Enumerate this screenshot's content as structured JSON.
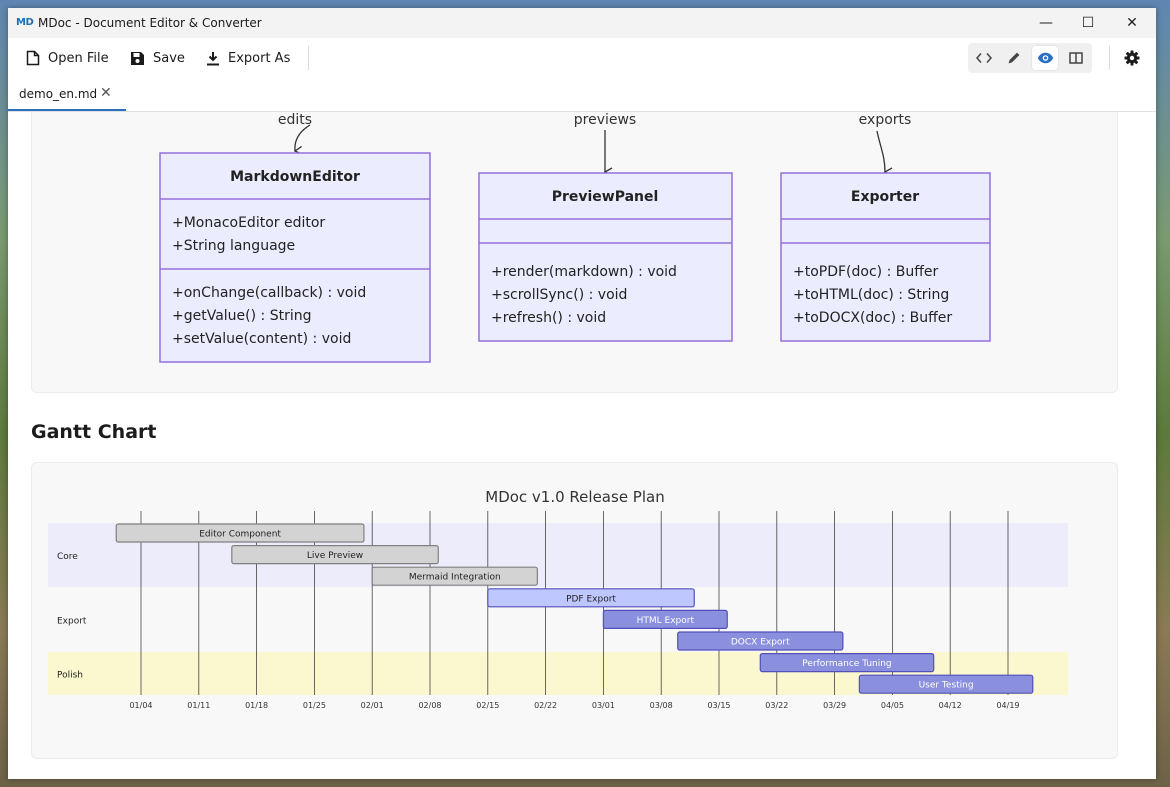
{
  "window": {
    "app_logo": "MD",
    "title": "MDoc - Document Editor & Converter",
    "controls": {
      "minimize": "—",
      "maximize": "☐",
      "close": "✕"
    }
  },
  "toolbar": {
    "open_label": "Open File",
    "save_label": "Save",
    "export_label": "Export As",
    "view_modes": [
      {
        "icon": "code-icon",
        "active": false
      },
      {
        "icon": "pencil-icon",
        "active": false
      },
      {
        "icon": "eye-icon",
        "active": true
      },
      {
        "icon": "split-view-icon",
        "active": false
      }
    ],
    "settings_icon": "gear-icon"
  },
  "tabs": [
    {
      "label": "demo_en.md",
      "close": "✕",
      "active": true
    }
  ],
  "class_diagram": {
    "relations": [
      "edits",
      "previews",
      "exports"
    ],
    "classes": [
      {
        "name": "MarkdownEditor",
        "attributes": [
          "+MonacoEditor editor",
          "+String language"
        ],
        "methods": [
          "+onChange(callback) : void",
          "+getValue() : String",
          "+setValue(content) : void"
        ]
      },
      {
        "name": "PreviewPanel",
        "attributes": [],
        "methods": [
          "+render(markdown) : void",
          "+scrollSync() : void",
          "+refresh() : void"
        ]
      },
      {
        "name": "Exporter",
        "attributes": [],
        "methods": [
          "+toPDF(doc) : Buffer",
          "+toHTML(doc) : String",
          "+toDOCX(doc) : Buffer"
        ]
      }
    ]
  },
  "gantt_heading": "Gantt Chart",
  "chart_data": {
    "type": "gantt",
    "title": "MDoc v1.0 Release Plan",
    "x_axis": "date",
    "x_ticks": [
      "01/04",
      "01/11",
      "01/18",
      "01/25",
      "02/01",
      "02/08",
      "02/15",
      "02/22",
      "03/01",
      "03/08",
      "03/15",
      "03/22",
      "03/29",
      "04/05",
      "04/12",
      "04/19"
    ],
    "sections": [
      {
        "name": "Core",
        "color": "#ececfb",
        "tasks": [
          {
            "name": "Editor Component",
            "start": "2025-01-01",
            "end": "2025-01-31",
            "status": "done"
          },
          {
            "name": "Live Preview",
            "start": "2025-01-15",
            "end": "2025-02-09",
            "status": "done"
          },
          {
            "name": "Mermaid Integration",
            "start": "2025-02-01",
            "end": "2025-02-21",
            "status": "done"
          }
        ]
      },
      {
        "name": "Export",
        "color": "#f8f8f8",
        "tasks": [
          {
            "name": "PDF Export",
            "start": "2025-02-15",
            "end": "2025-03-12",
            "status": "active"
          },
          {
            "name": "HTML Export",
            "start": "2025-03-01",
            "end": "2025-03-16",
            "status": "planned"
          },
          {
            "name": "DOCX Export",
            "start": "2025-03-10",
            "end": "2025-03-30",
            "status": "planned"
          }
        ]
      },
      {
        "name": "Polish",
        "color": "#fbf7cf",
        "tasks": [
          {
            "name": "Performance Tuning",
            "start": "2025-03-20",
            "end": "2025-04-10",
            "status": "planned"
          },
          {
            "name": "User Testing",
            "start": "2025-04-01",
            "end": "2025-04-22",
            "status": "planned"
          }
        ]
      }
    ],
    "status_colors": {
      "done": {
        "fill": "#d3d3d3",
        "stroke": "#808080",
        "text": "#222222"
      },
      "active": {
        "fill": "#bfc7ff",
        "stroke": "#534fbc",
        "text": "#222222"
      },
      "planned": {
        "fill": "#8a90dd",
        "stroke": "#534fbc",
        "text": "#ffffff"
      }
    }
  },
  "colors": {
    "accent": "#2b6fc4",
    "class_fill": "#ececff",
    "class_stroke": "#9370db"
  }
}
